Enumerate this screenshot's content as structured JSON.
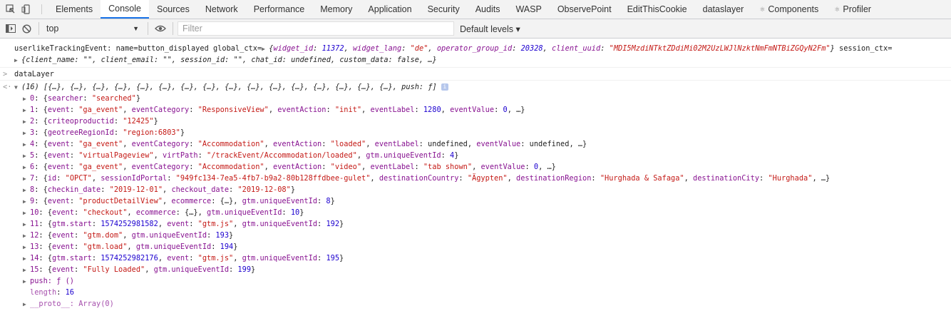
{
  "devtools": {
    "tabs": [
      "Elements",
      "Console",
      "Sources",
      "Network",
      "Performance",
      "Memory",
      "Application",
      "Security",
      "Audits",
      "WASP",
      "ObservePoint",
      "EditThisCookie",
      "dataslayer",
      "Components",
      "Profiler"
    ],
    "active_tab": "Console"
  },
  "console_toolbar": {
    "context": "top",
    "filter_placeholder": "Filter",
    "levels": "Default levels ▾"
  },
  "log_message": {
    "prefix": "userlikeTrackingEvent: name=button_displayed global_ctx=",
    "widget_id": "11372",
    "widget_lang": "\"de\"",
    "operator_group_id": "20328",
    "client_uuid": "\"MDI5MzdiNTktZDdiMi02M2UzLWJlNzktNmFmNTBiZGQyN2Fm\"",
    "session_ctx_label": "session_ctx=",
    "line2": "{client_name: \"\", client_email: \"\", session_id: \"\", chat_id: undefined, custom_data: false, …}"
  },
  "command": "dataLayer",
  "array_summary": "(16) [{…}, {…}, {…}, {…}, {…}, {…}, {…}, {…}, {…}, {…}, {…}, {…}, {…}, {…}, {…}, {…}, push: ƒ]",
  "entries": [
    "0: {searcher: \"searched\"}",
    "1: {event: \"ga_event\", eventCategory: \"ResponsiveView\", eventAction: \"init\", eventLabel: 1280, eventValue: 0, …}",
    "2: {criteoproductid: \"12425\"}",
    "3: {geotreeRegionId: \"region:6803\"}",
    "4: {event: \"ga_event\", eventCategory: \"Accommodation\", eventAction: \"loaded\", eventLabel: undefined, eventValue: undefined, …}",
    "5: {event: \"virtualPageview\", virtPath: \"/trackEvent/Accommodation/loaded\", gtm.uniqueEventId: 4}",
    "6: {event: \"ga_event\", eventCategory: \"Accommodation\", eventAction: \"video\", eventLabel: \"tab shown\", eventValue: 0, …}",
    "7: {id: \"OPCT\", sessionIdPortal: \"949fc134-7ea5-4fb7-b9a2-80b128ffdbee-gulet\", destinationCountry: \"Ägypten\", destinationRegion: \"Hurghada & Safaga\", destinationCity: \"Hurghada\", …}",
    "8: {checkin_date: \"2019-12-01\", checkout_date: \"2019-12-08\"}",
    "9: {event: \"productDetailView\", ecommerce: {…}, gtm.uniqueEventId: 8}",
    "10: {event: \"checkout\", ecommerce: {…}, gtm.uniqueEventId: 10}",
    "11: {gtm.start: 1574252981582, event: \"gtm.js\", gtm.uniqueEventId: 192}",
    "12: {event: \"gtm.dom\", gtm.uniqueEventId: 193}",
    "13: {event: \"gtm.load\", gtm.uniqueEventId: 194}",
    "14: {gtm.start: 1574252982176, event: \"gtm.js\", gtm.uniqueEventId: 195}",
    "15: {event: \"Fully Loaded\", gtm.uniqueEventId: 199}"
  ],
  "extra": {
    "push": "push: ƒ ()",
    "length_key": "length",
    "length_val": "16",
    "proto": "__proto__: Array(0)"
  },
  "colors": {
    "key": "#881391",
    "string": "#c41a16",
    "number": "#1c00cf",
    "accent": "#1a73e8"
  }
}
